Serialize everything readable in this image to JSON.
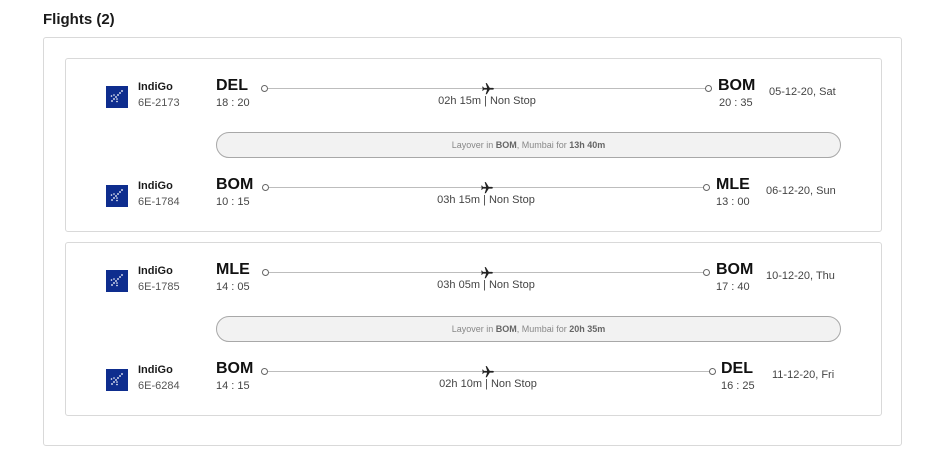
{
  "title": "Flights (2)",
  "groups": [
    {
      "segments": [
        {
          "airline": "IndiGo",
          "flight_no": "6E-2173",
          "from": "DEL",
          "dep_time": "18 : 20",
          "duration": "02h 15m | Non Stop",
          "to": "BOM",
          "arr_time": "20 : 35",
          "date": "05-12-20, Sat"
        },
        {
          "airline": "IndiGo",
          "flight_no": "6E-1784",
          "from": "BOM",
          "dep_time": "10 : 15",
          "duration": "03h 15m | Non Stop",
          "to": "MLE",
          "arr_time": "13 : 00",
          "date": "06-12-20, Sun"
        }
      ],
      "layover": {
        "prefix": "Layover in ",
        "airport": "BOM",
        "city": ", Mumbai for ",
        "duration": "13h 40m"
      }
    },
    {
      "segments": [
        {
          "airline": "IndiGo",
          "flight_no": "6E-1785",
          "from": "MLE",
          "dep_time": "14 : 05",
          "duration": "03h 05m | Non Stop",
          "to": "BOM",
          "arr_time": "17 : 40",
          "date": "10-12-20, Thu"
        },
        {
          "airline": "IndiGo",
          "flight_no": "6E-6284",
          "from": "BOM",
          "dep_time": "14 : 15",
          "duration": "02h 10m | Non Stop",
          "to": "DEL",
          "arr_time": "16 : 25",
          "date": "11-12-20, Fri"
        }
      ],
      "layover": {
        "prefix": "Layover in ",
        "airport": "BOM",
        "city": ", Mumbai for ",
        "duration": "20h 35m"
      }
    }
  ],
  "icons": {
    "airline_logo": "indigo-logo-icon",
    "plane": "plane-icon"
  },
  "colors": {
    "logo_bg": "#0e2d8e",
    "border": "#d9d9d9",
    "layover_bg": "#f2f2f2"
  }
}
